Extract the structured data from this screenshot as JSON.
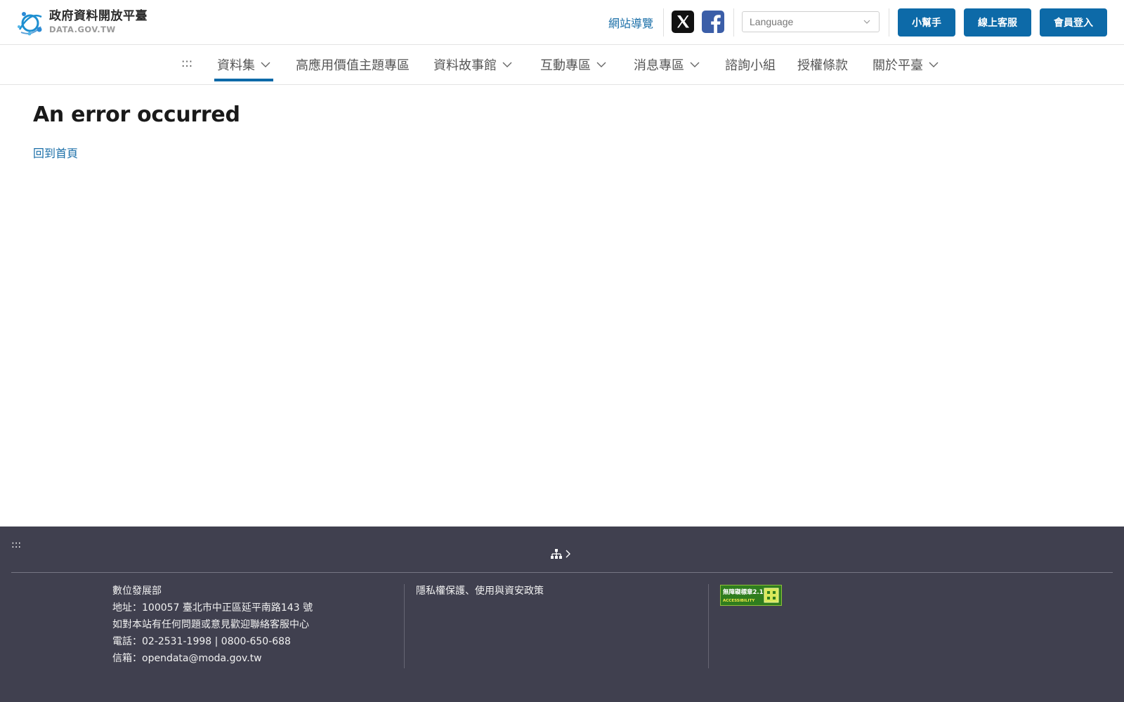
{
  "header": {
    "logo_title": "政府資料開放平臺",
    "logo_sub": "DATA.GOV.TW",
    "sitemap_label": "網站導覽",
    "language_placeholder": "Language",
    "buttons": {
      "helper": "小幫手",
      "support": "線上客服",
      "login": "會員登入"
    },
    "colors": {
      "primary": "#0d6aa8",
      "link": "#1b6fa8",
      "facebook": "#3b5ea8"
    }
  },
  "nav": {
    "accesskey": ":::",
    "items": [
      {
        "label": "資料集",
        "dropdown": true,
        "active": true
      },
      {
        "label": "高應用價值主題專區",
        "dropdown": false
      },
      {
        "label": "資料故事館",
        "dropdown": true
      },
      {
        "label": "互動專區",
        "dropdown": true
      },
      {
        "label": "消息專區",
        "dropdown": true
      },
      {
        "label": "諮詢小組",
        "dropdown": false
      },
      {
        "label": "授權條款",
        "dropdown": false
      },
      {
        "label": "關於平臺",
        "dropdown": true
      }
    ]
  },
  "main": {
    "title": "An error occurred",
    "home_link": "回到首頁"
  },
  "footer": {
    "accesskey": ":::",
    "org": "數位發展部",
    "address": "地址：100057 臺北市中正區延平南路143 號",
    "contact_note": "如對本站有任何問題或意見歡迎聯絡客服中心",
    "phone": "電話：02-2531-1998 | 0800-650-688",
    "email": "信箱：opendata@moda.gov.tw",
    "privacy": "隱私權保護、使用與資安政策",
    "badge_alt": "無障礙標章2.1",
    "badge_word": "ACCESSIBILITY",
    "background": "#40404f"
  }
}
